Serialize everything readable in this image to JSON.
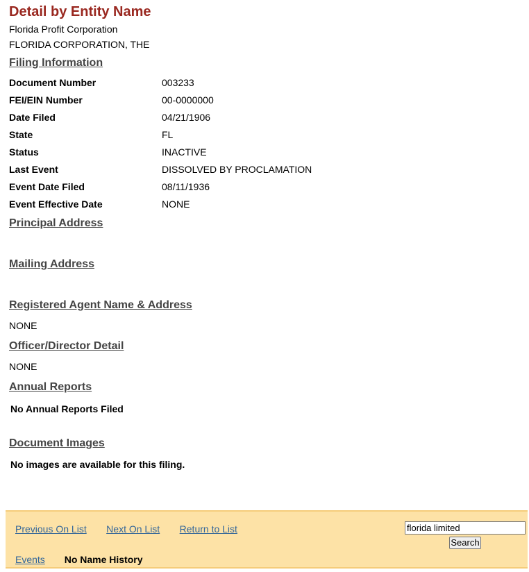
{
  "page": {
    "title": "Detail by Entity Name",
    "entity_type": "Florida Profit Corporation",
    "entity_name": "FLORIDA CORPORATION, THE"
  },
  "filing": {
    "section_title": "Filing Information",
    "rows": [
      {
        "label": "Document Number",
        "value": "003233"
      },
      {
        "label": "FEI/EIN Number",
        "value": "00-0000000"
      },
      {
        "label": "Date Filed",
        "value": "04/21/1906"
      },
      {
        "label": "State",
        "value": "FL"
      },
      {
        "label": "Status",
        "value": "INACTIVE"
      },
      {
        "label": "Last Event",
        "value": "DISSOLVED BY PROCLAMATION"
      },
      {
        "label": "Event Date Filed",
        "value": "08/11/1936"
      },
      {
        "label": "Event Effective Date",
        "value": "NONE"
      }
    ]
  },
  "principal_address": {
    "section_title": "Principal Address"
  },
  "mailing_address": {
    "section_title": "Mailing Address"
  },
  "registered_agent": {
    "section_title": "Registered Agent Name & Address",
    "value": "NONE"
  },
  "officer_detail": {
    "section_title": "Officer/Director Detail",
    "value": "NONE"
  },
  "annual_reports": {
    "section_title": "Annual Reports",
    "note": "No Annual Reports Filed"
  },
  "document_images": {
    "section_title": "Document Images",
    "note": "No images are available for this filing."
  },
  "footer": {
    "previous_label": "Previous On List",
    "next_label": "Next On List",
    "return_label": "Return to List",
    "events_label": "Events",
    "name_history_label": "No Name History",
    "search_value": "florida limited",
    "search_button": "Search"
  },
  "colors": {
    "title": "#99271f",
    "link": "#336699",
    "footer_bg": "#fde2a6"
  }
}
